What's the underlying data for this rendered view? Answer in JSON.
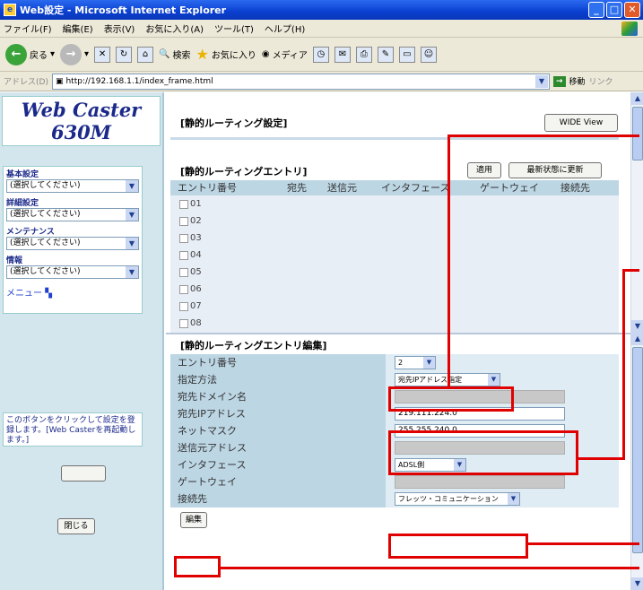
{
  "window": {
    "title": "Web設定 - Microsoft Internet Explorer"
  },
  "menubar": {
    "items": [
      "ファイル(F)",
      "編集(E)",
      "表示(V)",
      "お気に入り(A)",
      "ツール(T)",
      "ヘルプ(H)"
    ]
  },
  "toolbar": {
    "back": "戻る",
    "search": "検索",
    "favorites": "お気に入り",
    "media": "メディア"
  },
  "address": {
    "label": "アドレス(D)",
    "url": "http://192.168.1.1/index_frame.html",
    "go": "移動",
    "links": "リンク"
  },
  "sidebar": {
    "logo_line1": "Web Caster",
    "logo_line2": "630M",
    "sections": [
      {
        "label": "基本設定",
        "select": "(選択してください)"
      },
      {
        "label": "詳細設定",
        "select": "(選択してください)"
      },
      {
        "label": "メンテナンス",
        "select": "(選択してください)"
      },
      {
        "label": "情報",
        "select": "(選択してください)"
      }
    ],
    "menu_link": "メニュー",
    "info_text": "このボタンをクリックして設定を登録します。[Web Casterを再起動します。]",
    "close_button": "閉じる"
  },
  "top": {
    "page_title": "[静的ルーティング設定]",
    "wide_view": "WIDE View",
    "section_title": "[静的ルーティングエントリ]",
    "apply_button": "適用",
    "refresh_button": "最新状態に更新",
    "columns": [
      "エントリ番号",
      "宛先",
      "送信元",
      "インタフェース",
      "ゲートウェイ",
      "接続先"
    ],
    "rows": [
      "01",
      "02",
      "03",
      "04",
      "05",
      "06",
      "07",
      "08"
    ]
  },
  "edit": {
    "section_title": "[静的ルーティングエントリ編集]",
    "fields": [
      {
        "label": "エントリ番号",
        "value": "2"
      },
      {
        "label": "指定方法",
        "value": "宛先IPアドレス指定"
      },
      {
        "label": "宛先ドメイン名",
        "value": ""
      },
      {
        "label": "宛先IPアドレス",
        "value": "219.111.224.0"
      },
      {
        "label": "ネットマスク",
        "value": "255.255.240.0"
      },
      {
        "label": "送信元アドレス",
        "value": ""
      },
      {
        "label": "インタフェース",
        "value": "ADSL側"
      },
      {
        "label": "ゲートウェイ",
        "value": ""
      },
      {
        "label": "接続先",
        "value": "フレッツ・コミュニケーション"
      }
    ],
    "edit_button": "編集"
  },
  "colors": {
    "highlight": "#e00000",
    "label_bg": "#bcd6e4",
    "sidebar_bg": "#d3e6ee",
    "title_blue": "#0a3fd0"
  }
}
